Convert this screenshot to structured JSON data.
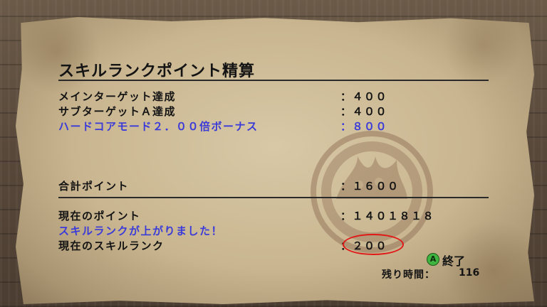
{
  "title": "スキルランクポイント精算",
  "items": [
    {
      "label": "メインターゲット達成",
      "value": "：４００"
    },
    {
      "label": "サブターゲットＡ達成",
      "value": "：４００"
    },
    {
      "label": "ハードコアモード２．００倍ボーナス",
      "value": "：８００"
    }
  ],
  "total": {
    "label": "合計ポイント",
    "value": "：１６００"
  },
  "current_points": {
    "label": "現在のポイント",
    "value": "：１４０１８１８"
  },
  "rank_up_message": "スキルランクが上がりました！",
  "current_rank": {
    "label": "現在のスキルランク",
    "value": "：２００"
  },
  "end_button": {
    "icon": "A",
    "label": "終了"
  },
  "time_remaining": {
    "label": "残り時間：",
    "value": "116"
  },
  "colors": {
    "highlight_text": "#3a3ad8",
    "circle": "#e01818",
    "a_button": "#3fb43f"
  }
}
